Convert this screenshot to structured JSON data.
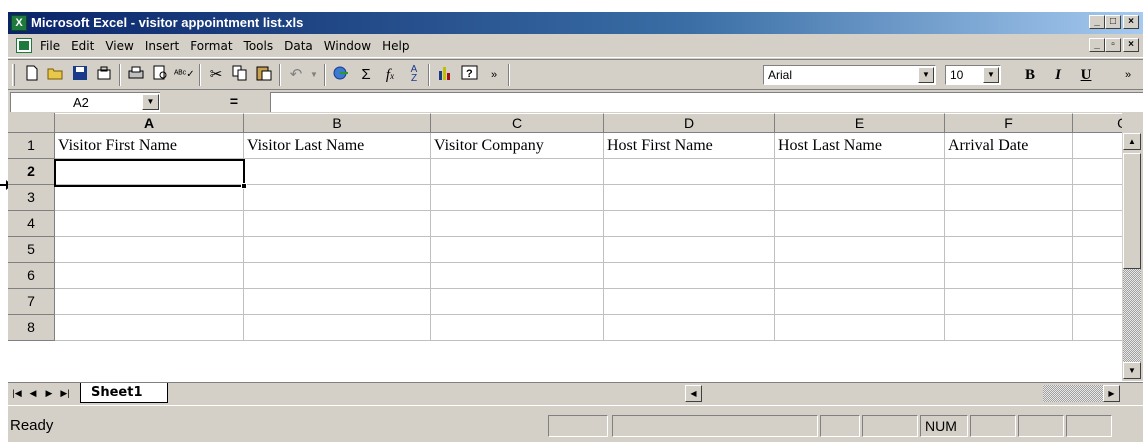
{
  "window": {
    "title": "Microsoft Excel - visitor appointment list.xls",
    "minimize": "_",
    "maximize": "□",
    "close": "×",
    "restore": "▫"
  },
  "menu": {
    "items": [
      "File",
      "Edit",
      "View",
      "Insert",
      "Format",
      "Tools",
      "Data",
      "Window",
      "Help"
    ]
  },
  "toolbar": {
    "icons": [
      "new-icon",
      "open-icon",
      "save-icon",
      "permission-icon",
      "print-icon",
      "print-preview-icon",
      "spelling-icon",
      "cut-icon",
      "copy-icon",
      "paste-icon",
      "undo-icon",
      "hyperlink-icon",
      "autosum-icon",
      "function-icon",
      "sort-ascending-icon",
      "chart-wizard-icon",
      "help-icon",
      "more-buttons-icon"
    ],
    "font_name": "Arial",
    "font_size": "10",
    "bold": "B",
    "italic": "I",
    "underline": "U"
  },
  "formula_bar": {
    "name_box": "A2",
    "equals": "=",
    "formula": ""
  },
  "columns": [
    "A",
    "B",
    "C",
    "D",
    "E",
    "F",
    "G"
  ],
  "rows": [
    "1",
    "2",
    "3",
    "4",
    "5",
    "6",
    "7",
    "8"
  ],
  "selected_cell": "A2",
  "cells": {
    "row1": [
      "Visitor First Name",
      "Visitor Last Name",
      "Visitor Company",
      "Host First Name",
      "Host Last Name",
      "Arrival Date",
      ""
    ]
  },
  "sheet_tabs": {
    "tabs": [
      "Sheet1"
    ],
    "active": "Sheet1"
  },
  "status": {
    "text": "Ready",
    "num_indicator": "NUM"
  },
  "colors": {
    "title_bar_start": "#0a246a",
    "title_bar_end": "#a6caf0",
    "chrome": "#d4d0c8",
    "excel_green": "#1e7a3c"
  }
}
